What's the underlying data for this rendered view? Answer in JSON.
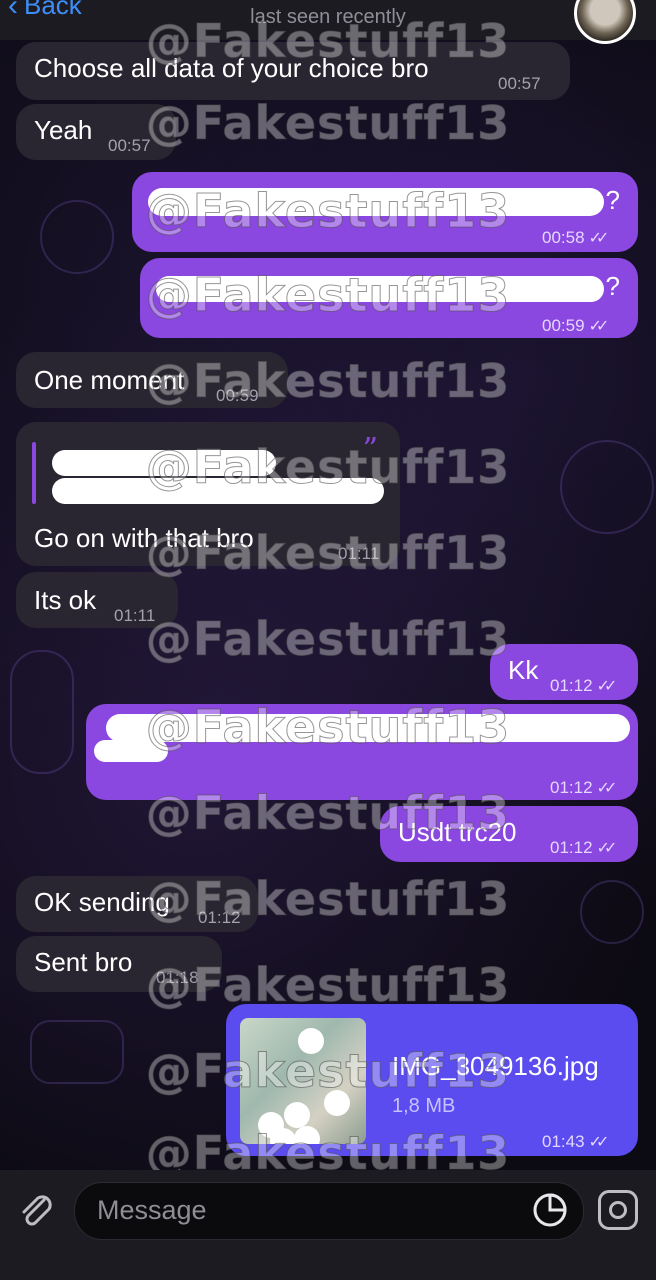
{
  "header": {
    "back_label": "Back",
    "status": "last seen recently"
  },
  "watermark": "@Fakestuff13",
  "messages": [
    {
      "dir": "in",
      "text": "Choose all data of your choice bro",
      "time": "00:57"
    },
    {
      "dir": "in",
      "text": "Yeah",
      "time": "00:57"
    },
    {
      "dir": "out",
      "text": "?",
      "time": "00:58",
      "redacted": true
    },
    {
      "dir": "out",
      "text": "?",
      "time": "00:59",
      "redacted": true
    },
    {
      "dir": "in",
      "text": "One moment",
      "time": "00:59"
    },
    {
      "dir": "in",
      "text": "Go on with that bro",
      "time": "01:11",
      "reply": true
    },
    {
      "dir": "in",
      "text": "Its ok",
      "time": "01:11"
    },
    {
      "dir": "out",
      "text": "Kk",
      "time": "01:12"
    },
    {
      "dir": "out",
      "text": "",
      "time": "01:12",
      "redacted": true
    },
    {
      "dir": "out",
      "text": "Usdt trc20",
      "time": "01:12"
    },
    {
      "dir": "in",
      "text": "OK sending",
      "time": "01:12"
    },
    {
      "dir": "in",
      "text": "Sent bro",
      "time": "01:18"
    },
    {
      "dir": "out",
      "file": "IMG_3049136.jpg",
      "size": "1,8 MB",
      "time": "01:43"
    }
  ],
  "composer": {
    "placeholder": "Message"
  },
  "icons": [
    "chevron-left-icon",
    "attach-icon",
    "sticker-icon",
    "camera-icon",
    "double-check-icon",
    "quote-icon"
  ],
  "colors": {
    "outgoing": "#8b48e0",
    "incoming": "#2a2631",
    "accent": "#3d8ef7",
    "file_bubble": "#5b4cf0"
  }
}
